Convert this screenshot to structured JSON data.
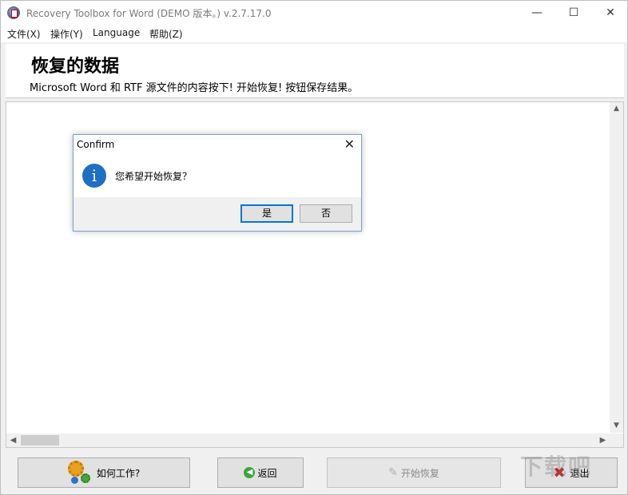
{
  "window": {
    "title": "Recovery Toolbox for Word (DEMO 版本。) v.2.7.17.0",
    "minimize": "—",
    "maximize": "☐",
    "close": "✕"
  },
  "menu": [
    "文件(X)",
    "操作(Y)",
    "Language",
    "帮助(Z)"
  ],
  "header": {
    "title": "恢复的数据",
    "subtitle": "Microsoft Word 和 RTF 源文件的内容按下! 开始恢复! 按钮保存结果。"
  },
  "scroll": {
    "up": "▲",
    "down": "▼",
    "left": "◀",
    "right": "▶"
  },
  "buttons": {
    "how": "如何工作?",
    "back": "返回",
    "start": "开始恢复",
    "exit": "退出"
  },
  "dialog": {
    "title": "Confirm",
    "close": "✕",
    "icon": "i",
    "message": "您希望开始恢复？",
    "yes": "是",
    "no": "否"
  },
  "watermark": "下载吧",
  "icons": {
    "app": "app-icon",
    "how": "gears-icon",
    "back": "back-arrow-icon",
    "start": "wand-icon",
    "exit": "x-icon",
    "dialog": "info-icon"
  },
  "colors": {
    "accent": "#0078d7",
    "info": "#1f6fc5",
    "exit": "#c81e1e"
  }
}
